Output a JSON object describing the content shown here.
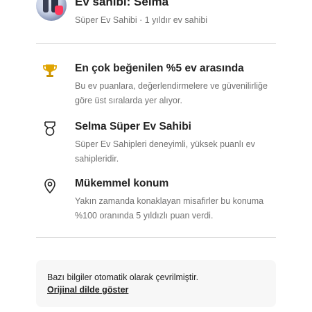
{
  "host": {
    "name": "Ev sahibi: Selma",
    "subtitle": "Süper Ev Sahibi · 1 yıldır ev sahibi"
  },
  "highlights": [
    {
      "icon": "trophy-icon",
      "title": "En çok beğenilen %5 ev arasında",
      "description": "Bu ev puanlara, değerlendirmelere ve güvenilirliğe göre üst sıralarda yer alıyor."
    },
    {
      "icon": "superhost-medal-icon",
      "title": "Selma Süper Ev Sahibi",
      "description": "Süper Ev Sahipleri deneyimli, yüksek puanlı ev sahipleridir."
    },
    {
      "icon": "location-pin-icon",
      "title": "Mükemmel konum",
      "description": "Yakın zamanda konaklayan misafirler bu konuma %100 oranında 5 yıldızlı puan verdi."
    }
  ],
  "translation_note": {
    "text": "Bazı bilgiler otomatik olarak çevrilmiştir.",
    "link_label": "Orijinal dilde göster"
  },
  "colors": {
    "primary_text": "#222222",
    "secondary_text": "#717171",
    "divider": "#dddddd",
    "note_background": "#f7f7f7",
    "trophy": "#e0a400",
    "brand_accent": "#ff385c"
  }
}
